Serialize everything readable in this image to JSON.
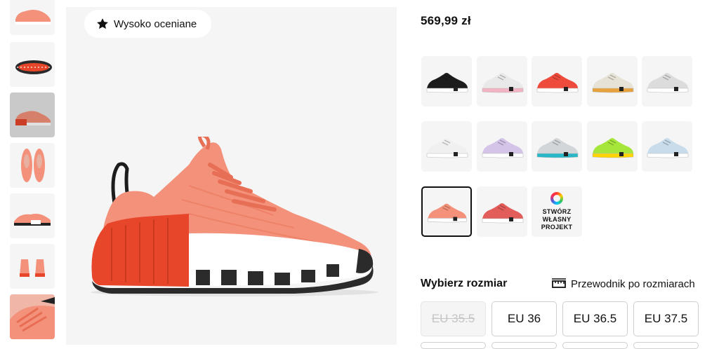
{
  "badge": {
    "label": "Wysoko oceniane",
    "icon": "star-icon"
  },
  "product": {
    "price": "569,99 zł"
  },
  "variants": {
    "custom_label": "STWÓRZ WŁASNY PROJEKT",
    "colors": [
      {
        "name": "black",
        "upper": "#1c1c1c",
        "sole": "#ffffff"
      },
      {
        "name": "white-pink",
        "upper": "#e9e9ea",
        "sole": "#f2b4c3"
      },
      {
        "name": "red",
        "upper": "#ee4b3c",
        "sole": "#ffffff"
      },
      {
        "name": "cream",
        "upper": "#e6e2d6",
        "sole": "#e6a23c"
      },
      {
        "name": "light-grey",
        "upper": "#dcdcdc",
        "sole": "#ffffff"
      },
      {
        "name": "white",
        "upper": "#f0f0f0",
        "sole": "#ffffff"
      },
      {
        "name": "lilac",
        "upper": "#d4c4e8",
        "sole": "#ffffff"
      },
      {
        "name": "grey-teal",
        "upper": "#d2d6d8",
        "sole": "#29b6c6"
      },
      {
        "name": "volt",
        "upper": "#a6e63a",
        "sole": "#ffd400"
      },
      {
        "name": "light-blue",
        "upper": "#c8dceb",
        "sole": "#ffffff"
      },
      {
        "name": "coral-selected",
        "upper": "#f4917a",
        "sole": "#ffffff"
      },
      {
        "name": "red-pattern",
        "upper": "#e25d5a",
        "sole": "#ffffff"
      }
    ]
  },
  "sizes": {
    "title": "Wybierz rozmiar",
    "guide_label": "Przewodnik po rozmiarach",
    "options": [
      {
        "label": "EU 35.5",
        "available": false
      },
      {
        "label": "EU 36",
        "available": true
      },
      {
        "label": "EU 36.5",
        "available": true
      },
      {
        "label": "EU 37.5",
        "available": true
      }
    ]
  },
  "colors": {
    "coral": "#f4917a",
    "orange_heel": "#e8462a",
    "panel_bg": "#f5f5f5"
  }
}
